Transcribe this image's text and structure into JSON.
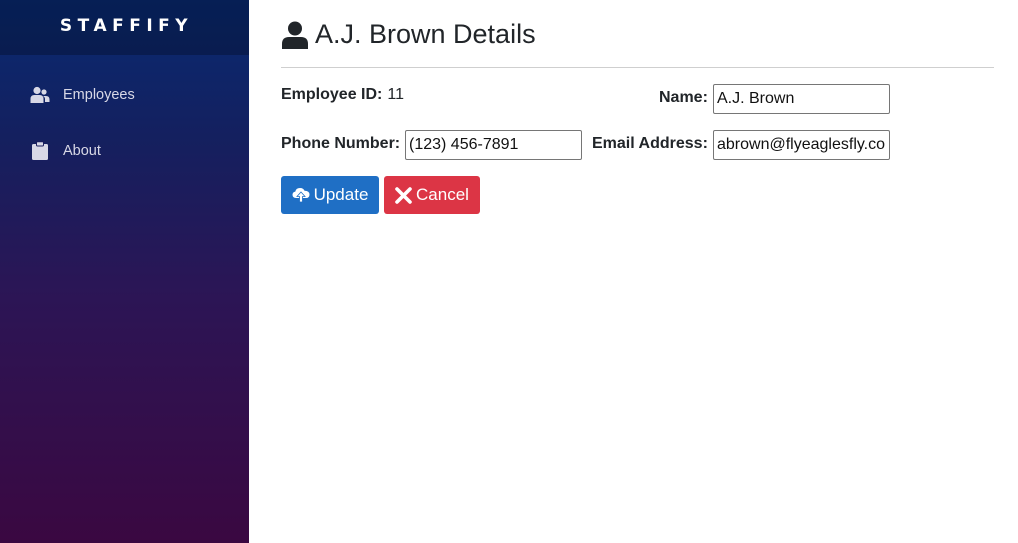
{
  "brand": {
    "name": "STAFFIFY"
  },
  "sidebar": {
    "items": [
      {
        "label": "Employees",
        "icon": "users-icon"
      },
      {
        "label": "About",
        "icon": "clipboard-icon"
      }
    ]
  },
  "page": {
    "title": "A.J. Brown Details",
    "icon": "user-icon"
  },
  "form": {
    "employee_id_label": "Employee ID:",
    "employee_id_value": "11",
    "name_label": "Name:",
    "name_value": "A.J. Brown",
    "phone_label": "Phone Number:",
    "phone_value": "(123) 456-7891",
    "email_label": "Email Address:",
    "email_value": "abrown@flyeaglesfly.co"
  },
  "actions": {
    "update_label": "Update",
    "update_icon": "cloud-upload-icon",
    "cancel_label": "Cancel",
    "cancel_icon": "x-icon"
  },
  "colors": {
    "update": "#1f6fc5",
    "cancel": "#dc3545",
    "sidebar_top": "#082a72",
    "sidebar_bottom": "#3a0841"
  }
}
